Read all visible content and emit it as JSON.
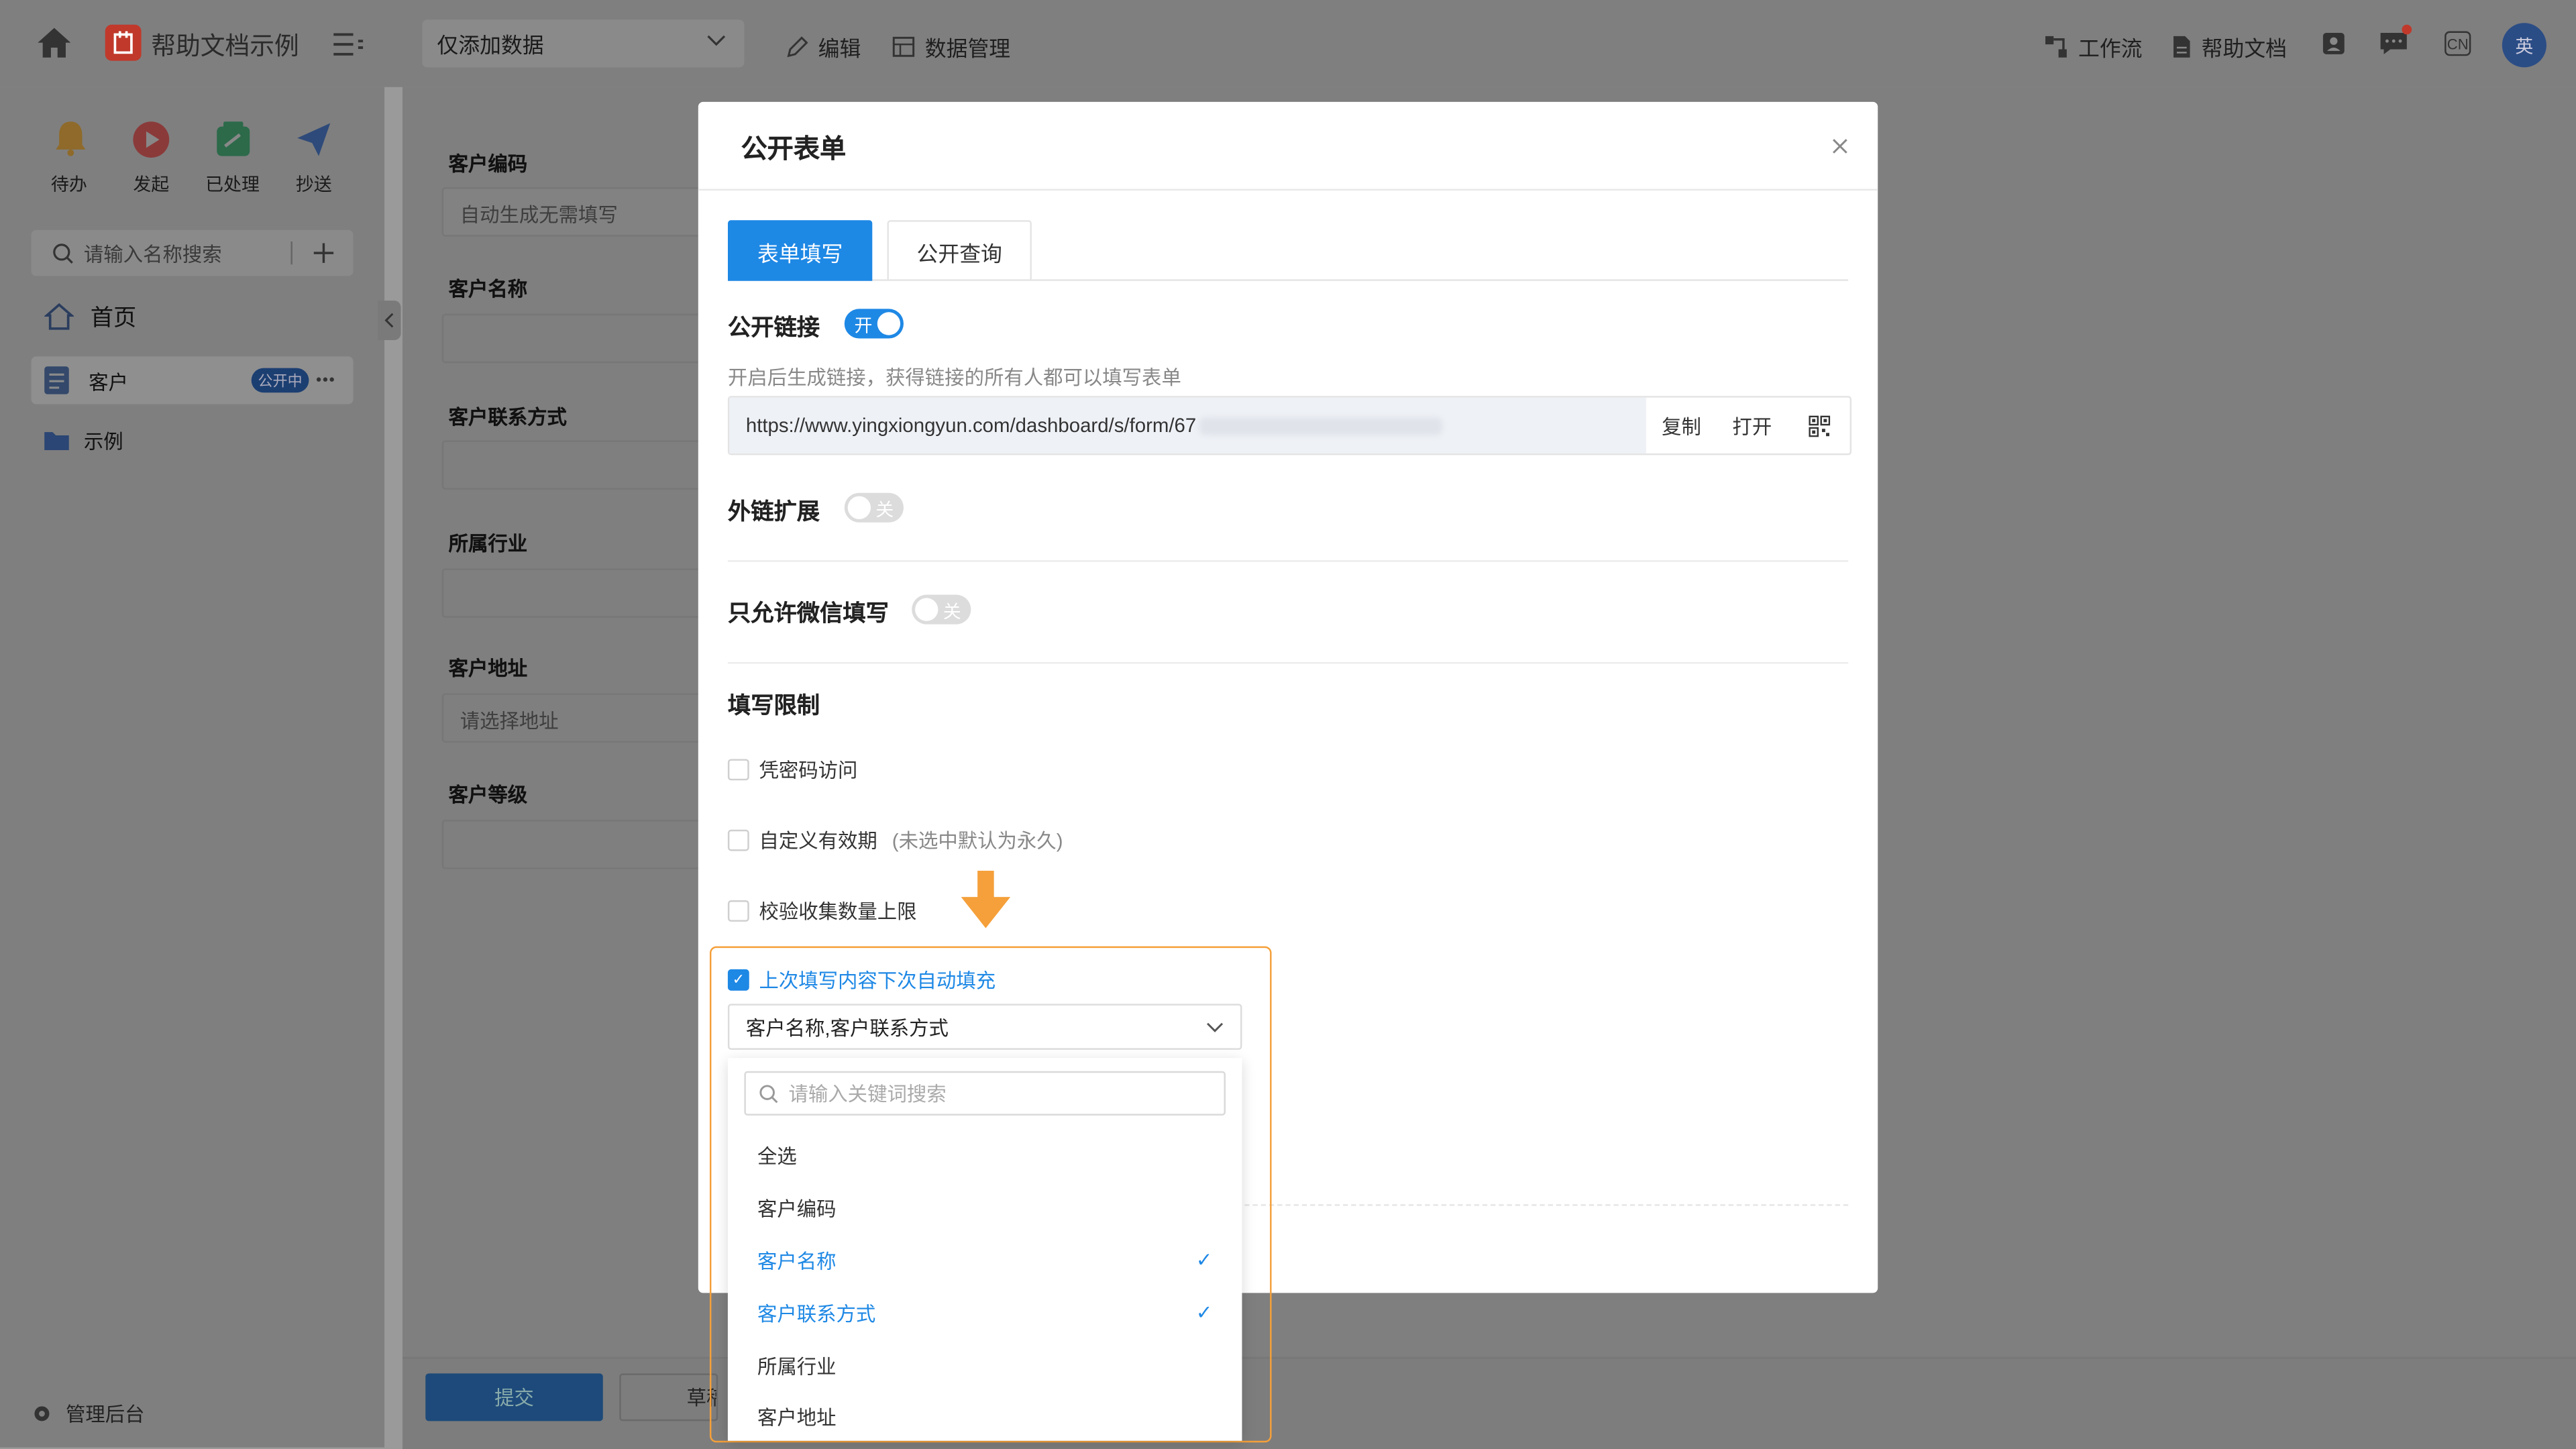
{
  "topbar": {
    "app_name": "帮助文档示例",
    "view_select": "仅添加数据",
    "edit_label": "编辑",
    "data_manage_label": "数据管理",
    "workflow_label": "工作流",
    "help_doc_label": "帮助文档",
    "lang_badge": "CN",
    "avatar_text": "英"
  },
  "sidebar": {
    "quick": [
      {
        "label": "待办",
        "icon": "bell-icon",
        "color": "#f0a020"
      },
      {
        "label": "发起",
        "icon": "play-icon",
        "color": "#e04040"
      },
      {
        "label": "已处理",
        "icon": "done-icon",
        "color": "#20a060"
      },
      {
        "label": "抄送",
        "icon": "send-icon",
        "color": "#3070d0"
      }
    ],
    "search_placeholder": "请输入名称搜索",
    "home_label": "首页",
    "items": [
      {
        "label": "客户",
        "badge": "公开中"
      },
      {
        "label": "示例"
      }
    ],
    "admin_label": "管理后台"
  },
  "form": {
    "fields": [
      {
        "label": "客户编码",
        "placeholder": "自动生成无需填写"
      },
      {
        "label": "客户名称",
        "placeholder": ""
      },
      {
        "label": "客户联系方式",
        "placeholder": ""
      },
      {
        "label": "所属行业",
        "placeholder": ""
      },
      {
        "label": "客户地址",
        "placeholder": "请选择地址"
      },
      {
        "label": "客户等级",
        "placeholder": ""
      }
    ],
    "submit_label": "提交",
    "draft_label": "草稿"
  },
  "modal": {
    "title": "公开表单",
    "tabs": [
      "表单填写",
      "公开查询"
    ],
    "public_link_label": "公开链接",
    "toggle_on": "开",
    "toggle_off": "关",
    "public_link_hint": "开启后生成链接，获得链接的所有人都可以填写表单",
    "url": "https://www.yingxiongyun.com/dashboard/s/form/67",
    "copy_label": "复制",
    "open_label": "打开",
    "ext_link_label": "外链扩展",
    "wechat_only_label": "只允许微信填写",
    "limit_label": "填写限制",
    "options": [
      {
        "label": "凭密码访问",
        "checked": false
      },
      {
        "label": "自定义有效期",
        "extra": "(未选中默认为永久)",
        "checked": false
      },
      {
        "label": "校验收集数量上限",
        "checked": false
      },
      {
        "label": "上次填写内容下次自动填充",
        "checked": true
      }
    ],
    "autofill_value": "客户名称,客户联系方式",
    "dropdown": {
      "search_placeholder": "请输入关键词搜索",
      "items": [
        {
          "label": "全选",
          "selected": false
        },
        {
          "label": "客户编码",
          "selected": false
        },
        {
          "label": "客户名称",
          "selected": true
        },
        {
          "label": "客户联系方式",
          "selected": true
        },
        {
          "label": "所属行业",
          "selected": false
        },
        {
          "label": "客户地址",
          "selected": false
        }
      ]
    }
  },
  "colors": {
    "accent": "#1e88e5",
    "highlight": "#f5a03a"
  }
}
